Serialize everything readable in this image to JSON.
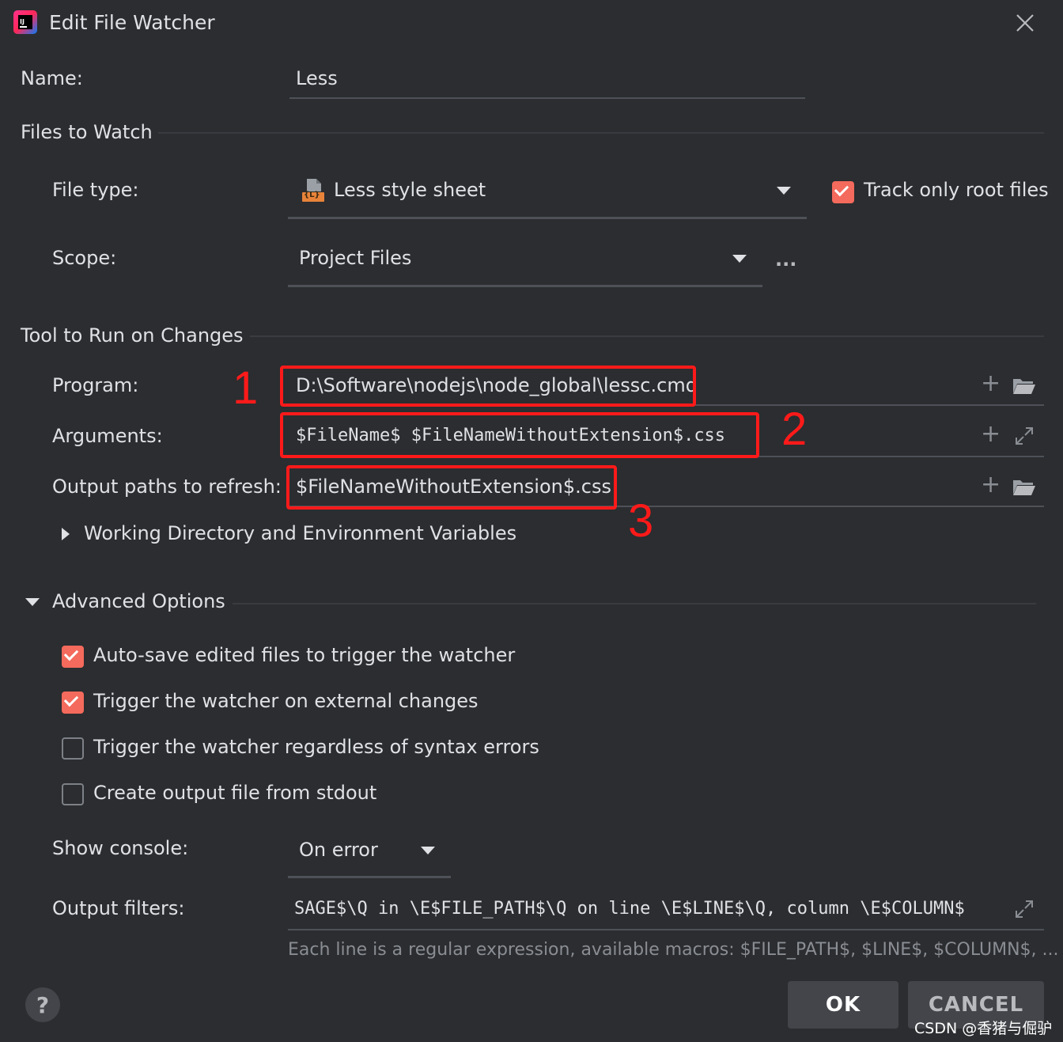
{
  "window": {
    "title": "Edit File Watcher"
  },
  "name": {
    "label": "Name:",
    "value": "Less"
  },
  "files_to_watch": {
    "title": "Files to Watch",
    "file_type_label": "File type:",
    "file_type_value": "Less style sheet",
    "file_type_icon_text": "{L}",
    "track_root_label": "Track only root files",
    "track_root_checked": true,
    "scope_label": "Scope:",
    "scope_value": "Project Files",
    "scope_more": "..."
  },
  "tool": {
    "title": "Tool to Run on Changes",
    "program_label": "Program:",
    "program_value": "D:\\Software\\nodejs\\node_global\\lessc.cmd",
    "arguments_label": "Arguments:",
    "arguments_value": "$FileName$ $FileNameWithoutExtension$.css",
    "output_label": "Output paths to refresh:",
    "output_value": "$FileNameWithoutExtension$.css",
    "working_dir_label": "Working Directory and Environment Variables"
  },
  "annotations": {
    "n1": "1",
    "n2": "2",
    "n3": "3"
  },
  "advanced": {
    "title": "Advanced Options",
    "options": [
      {
        "label": "Auto-save edited files to trigger the watcher",
        "checked": true
      },
      {
        "label": "Trigger the watcher on external changes",
        "checked": true
      },
      {
        "label": "Trigger the watcher regardless of syntax errors",
        "checked": false
      },
      {
        "label": "Create output file from stdout",
        "checked": false
      }
    ],
    "show_console_label": "Show console:",
    "show_console_value": "On error",
    "output_filters_label": "Output filters:",
    "output_filters_value": "SAGE$\\Q in \\E$FILE_PATH$\\Q on line \\E$LINE$\\Q, column \\E$COLUMN$",
    "hint": "Each line is a regular expression, available macros: $FILE_PATH$, $LINE$, $COLUMN$, ..."
  },
  "footer": {
    "help": "?",
    "ok": "OK",
    "cancel": "CANCEL",
    "watermark": "CSDN @香猪与倔驴"
  },
  "colors": {
    "accent": "#f46a5c",
    "annotation": "#ff1a1a",
    "background": "#2b2d30"
  }
}
